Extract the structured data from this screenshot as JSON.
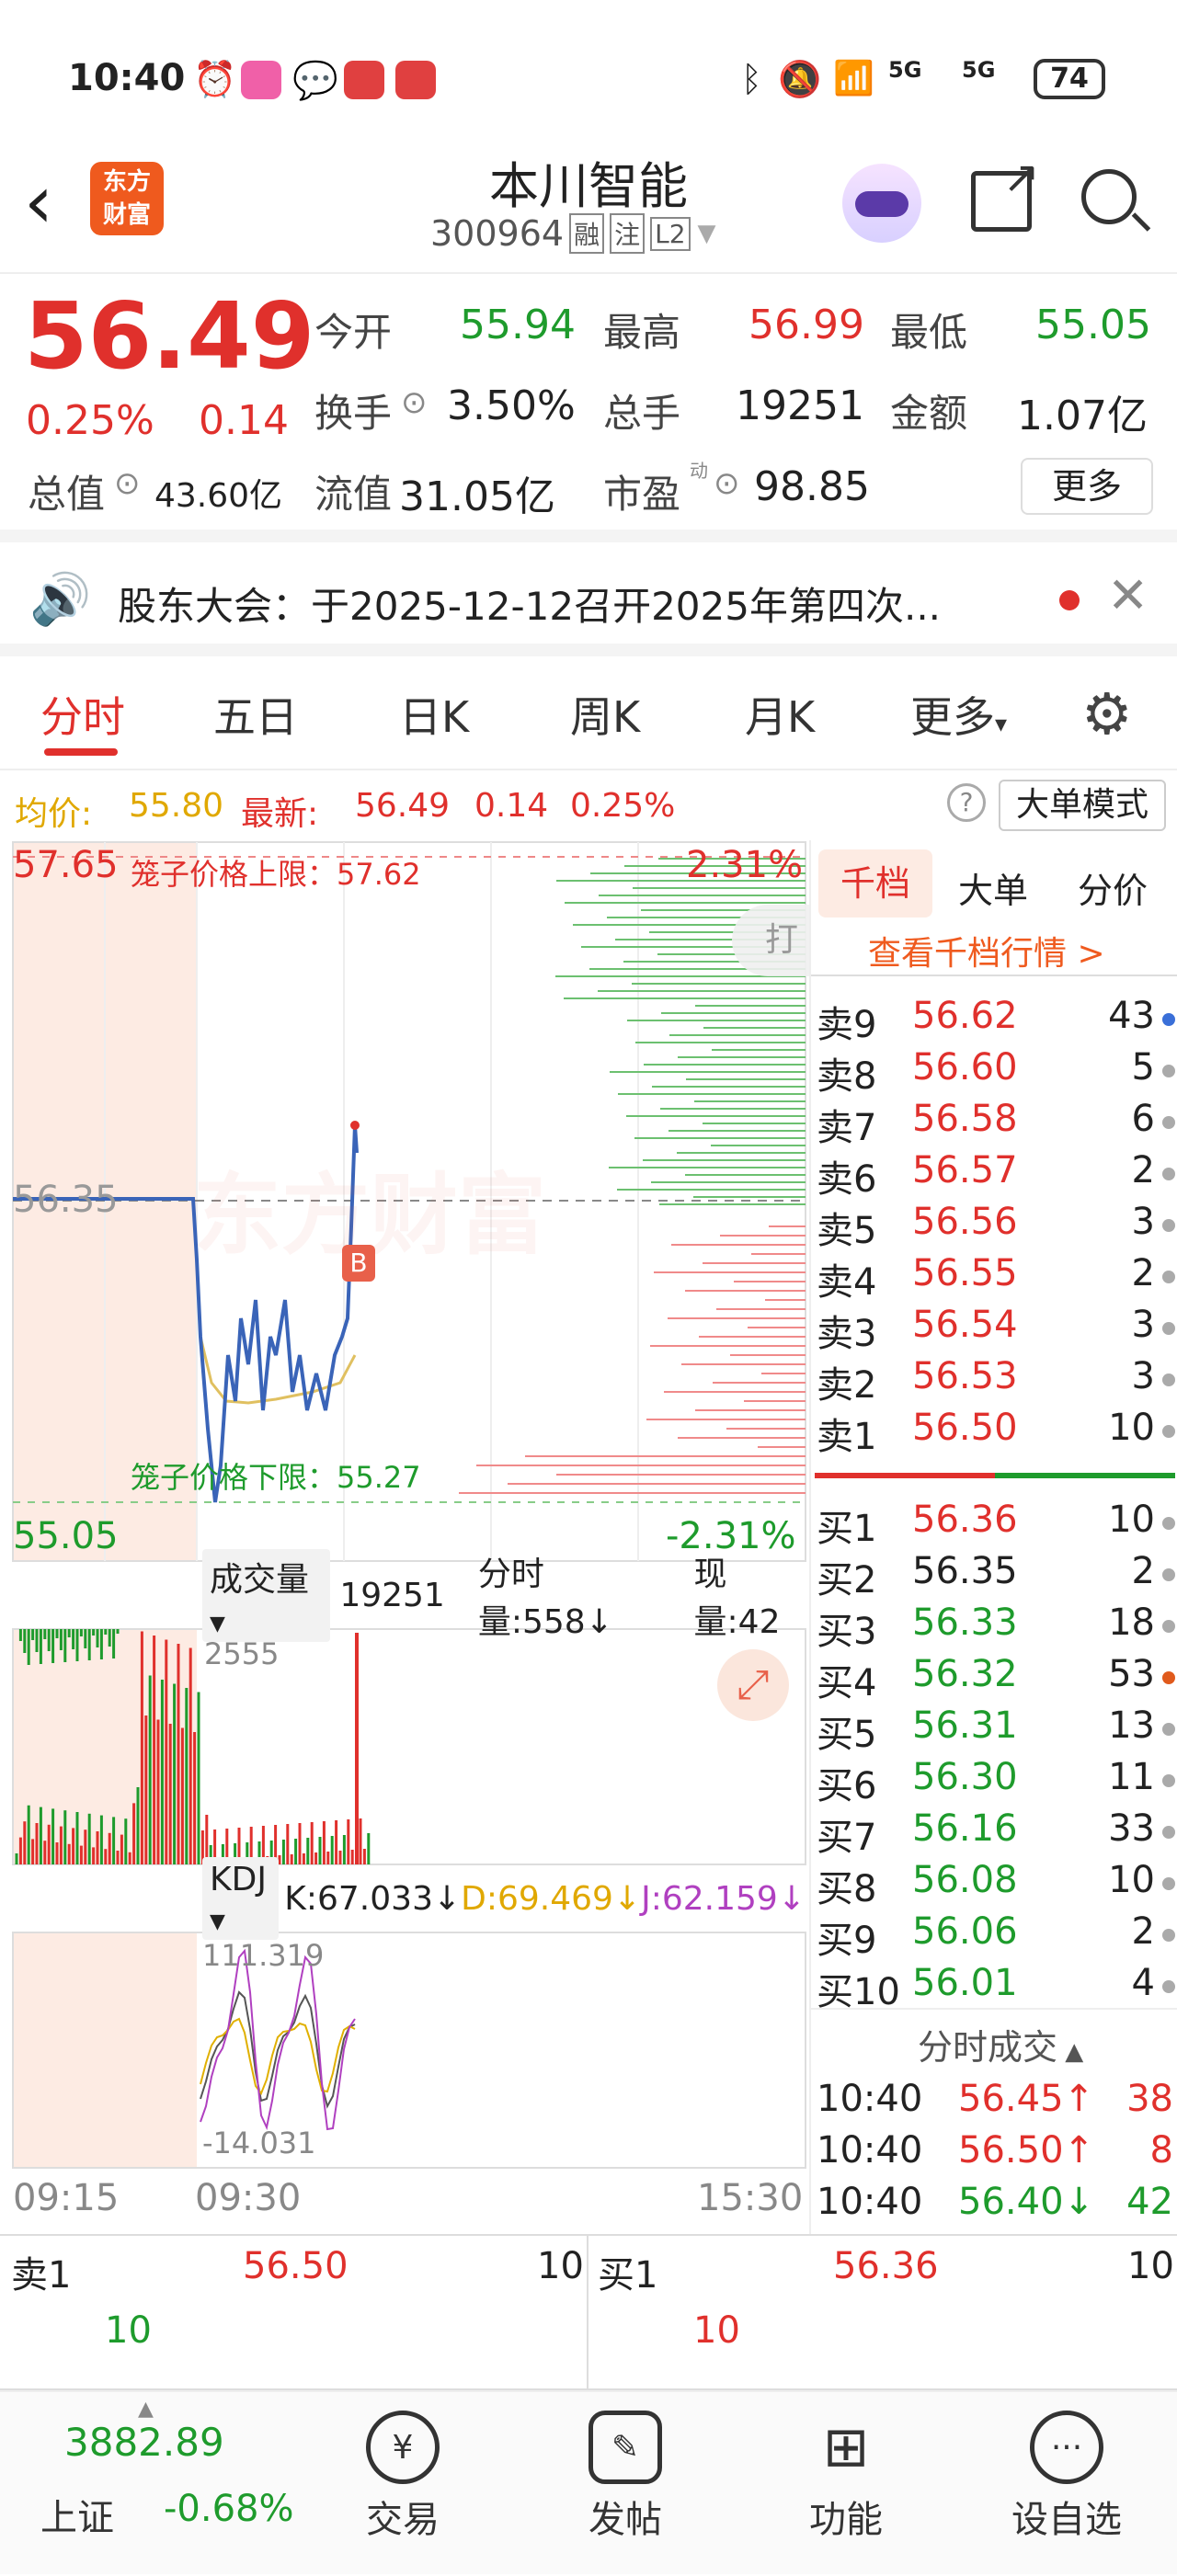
{
  "status": {
    "time": "10:40",
    "battery": "74",
    "net1": "5G",
    "net2": "5G"
  },
  "header": {
    "title": "本川智能",
    "code": "300964",
    "tags": [
      "融",
      "注",
      "L2"
    ],
    "logo_line1": "东方",
    "logo_line2": "财富"
  },
  "quote": {
    "price": "56.49",
    "change_pct": "0.25%",
    "change": "0.14",
    "open_label": "今开",
    "open": "55.94",
    "high_label": "最高",
    "high": "56.99",
    "low_label": "最低",
    "low": "55.05",
    "turnover_label": "换手",
    "turnover": "3.50%",
    "volume_label": "总手",
    "volume": "19251",
    "amount_label": "金额",
    "amount": "1.07亿",
    "mktcap_label": "总值",
    "mktcap": "43.60亿",
    "float_label": "流值",
    "float": "31.05亿",
    "pe_label": "市盈",
    "pe_sup": "动",
    "pe": "98.85",
    "more": "更多"
  },
  "notice": {
    "text": "股东大会：于2025-12-12召开2025年第四次..."
  },
  "tabs": [
    "分时",
    "五日",
    "日K",
    "周K",
    "月K",
    "更多"
  ],
  "infobar": {
    "avg_label": "均价:",
    "avg": "55.80",
    "last_label": "最新:",
    "last": "56.49",
    "chg": "0.14",
    "pct": "0.25%",
    "mode": "大单模式"
  },
  "chart": {
    "max": "57.65",
    "upper_limit": "笼子价格上限：57.62",
    "pct_up": "2.31%",
    "mid": "56.35",
    "lower_limit": "笼子价格下限：55.27",
    "min": "55.05",
    "pct_down": "-2.31%",
    "watermark": "东方财富",
    "marker": "B",
    "hit": "打",
    "vol_label": "成交量",
    "vol_total": "19251",
    "vol_min": "分时量:558↓",
    "vol_now": "现量:42",
    "vol_max": "2555",
    "kdj_label": "KDJ",
    "k": "K:67.033↓",
    "d": "D:69.469↓",
    "j": "J:62.159↓",
    "kdj_max": "111.319",
    "kdj_min": "-14.031",
    "times": [
      "09:15",
      "09:30",
      "15:30"
    ]
  },
  "book": {
    "tabs": [
      "千档",
      "大单",
      "分价"
    ],
    "link": "查看千档行情 >",
    "sells": [
      {
        "l": "卖9",
        "p": "56.62",
        "v": "43",
        "dot": "#3a6fd8"
      },
      {
        "l": "卖8",
        "p": "56.60",
        "v": "5",
        "dot": "#aaa"
      },
      {
        "l": "卖7",
        "p": "56.58",
        "v": "6",
        "dot": "#aaa"
      },
      {
        "l": "卖6",
        "p": "56.57",
        "v": "2",
        "dot": "#aaa"
      },
      {
        "l": "卖5",
        "p": "56.56",
        "v": "3",
        "dot": "#aaa"
      },
      {
        "l": "卖4",
        "p": "56.55",
        "v": "2",
        "dot": "#aaa"
      },
      {
        "l": "卖3",
        "p": "56.54",
        "v": "3",
        "dot": "#aaa"
      },
      {
        "l": "卖2",
        "p": "56.53",
        "v": "3",
        "dot": "#aaa"
      },
      {
        "l": "卖1",
        "p": "56.50",
        "v": "10",
        "dot": "#aaa"
      }
    ],
    "buys": [
      {
        "l": "买1",
        "p": "56.36",
        "v": "10",
        "dot": "#aaa"
      },
      {
        "l": "买2",
        "p": "56.35",
        "v": "2",
        "dot": "#aaa"
      },
      {
        "l": "买3",
        "p": "56.33",
        "v": "18",
        "dot": "#aaa"
      },
      {
        "l": "买4",
        "p": "56.32",
        "v": "53",
        "dot": "#e05a1c"
      },
      {
        "l": "买5",
        "p": "56.31",
        "v": "13",
        "dot": "#aaa"
      },
      {
        "l": "买6",
        "p": "56.30",
        "v": "11",
        "dot": "#aaa"
      },
      {
        "l": "买7",
        "p": "56.16",
        "v": "33",
        "dot": "#aaa"
      },
      {
        "l": "买8",
        "p": "56.08",
        "v": "10",
        "dot": "#aaa"
      },
      {
        "l": "买9",
        "p": "56.06",
        "v": "2",
        "dot": "#aaa"
      },
      {
        "l": "买10",
        "p": "56.01",
        "v": "4",
        "dot": "#aaa"
      }
    ],
    "trades_label": "分时成交",
    "trades": [
      {
        "t": "10:40",
        "p": "56.45↑",
        "v": "38"
      },
      {
        "t": "10:40",
        "p": "56.50↑",
        "v": "8"
      },
      {
        "t": "10:40",
        "p": "56.40↓",
        "v": "42"
      }
    ]
  },
  "bottom": {
    "sell_label": "卖1",
    "sell_price": "56.50",
    "sell_vol": "10",
    "sell_sub": "10",
    "buy_label": "买1",
    "buy_price": "56.36",
    "buy_vol": "10",
    "buy_sub": "10"
  },
  "nav": {
    "index_value": "3882.89",
    "index_name": "上证",
    "index_pct": "-0.68%",
    "trade": "交易",
    "post": "发帖",
    "func": "功能",
    "watch": "设自选"
  }
}
